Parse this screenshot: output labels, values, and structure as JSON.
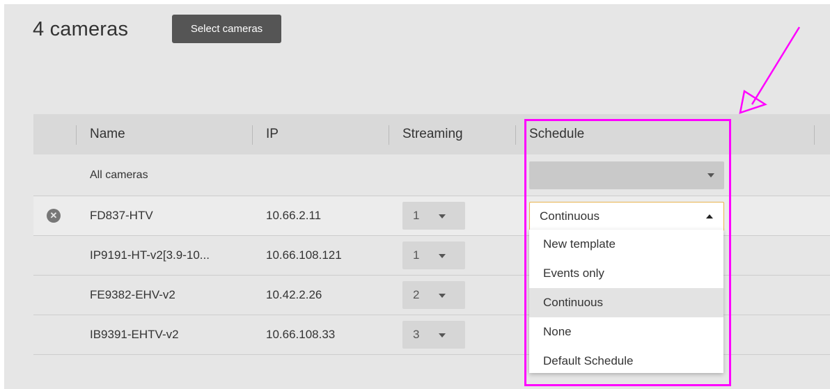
{
  "header": {
    "title": "4 cameras",
    "select_button_label": "Select cameras"
  },
  "table": {
    "columns": [
      "",
      "Name",
      "IP",
      "Streaming",
      "Schedule"
    ],
    "all_cameras_label": "All cameras",
    "rows": [
      {
        "name": "FD837-HTV",
        "ip": "10.66.2.11",
        "streaming": "1",
        "schedule": "Continuous",
        "has_remove": true
      },
      {
        "name": "IP9191-HT-v2[3.9-10...",
        "ip": "10.66.108.121",
        "streaming": "1"
      },
      {
        "name": "FE9382-EHV-v2",
        "ip": "10.42.2.26",
        "streaming": "2"
      },
      {
        "name": "IB9391-EHTV-v2",
        "ip": "10.66.108.33",
        "streaming": "3"
      }
    ]
  },
  "schedule_dropdown": {
    "open": true,
    "selected": "Continuous",
    "options": [
      "New template",
      "Events only",
      "Continuous",
      "None",
      "Default Schedule"
    ]
  },
  "icons": {
    "remove": "close-circle-icon",
    "dropdown": "chevron-down-icon",
    "dropdown_open": "chevron-up-icon"
  },
  "colors": {
    "panel_bg": "#e6e6e6",
    "header_bg": "#d9d9d9",
    "button_bg": "#555555",
    "focus_border": "#e8b34d",
    "annotation": "#ff00ff"
  }
}
